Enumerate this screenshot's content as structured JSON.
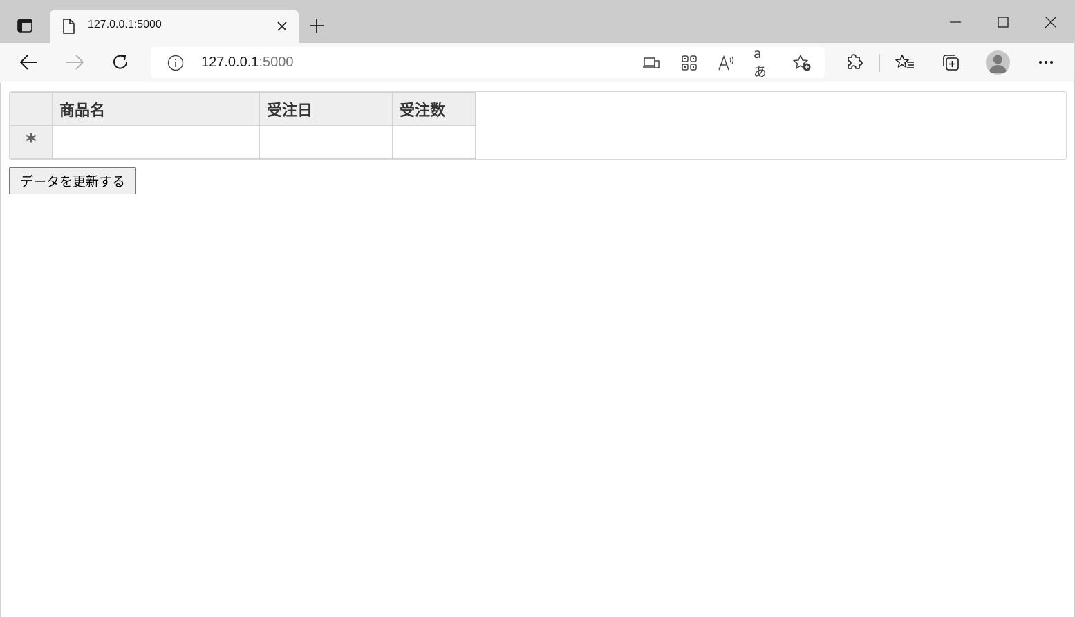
{
  "browser": {
    "tab": {
      "title": "127.0.0.1:5000"
    },
    "address": {
      "host": "127.0.0.1",
      "port": ":5000"
    }
  },
  "icons": {
    "tab_actions": "tab-actions-icon",
    "page": "page-icon",
    "close": "close-icon",
    "new_tab": "plus-icon",
    "back": "back-arrow-icon",
    "forward": "forward-arrow-icon",
    "refresh": "refresh-icon",
    "info": "info-icon",
    "app_available": "app-available-icon",
    "qr": "qr-code-icon",
    "read_aloud": "read-aloud-icon",
    "translate": "translate-icon",
    "add_favorite": "star-plus-icon",
    "extensions": "puzzle-icon",
    "favorites": "favorites-icon",
    "collections": "collections-icon",
    "profile": "profile-avatar",
    "more": "more-icon"
  },
  "grid": {
    "columns": [
      "商品名",
      "受注日",
      "受注数"
    ],
    "new_row_marker": "*"
  },
  "actions": {
    "update_label": "データを更新する"
  },
  "colors": {
    "titlebar": "#cccccc",
    "toolbar": "#f7f7f7",
    "header_bg": "#eeeeee",
    "grid_border": "#d3d3d3"
  }
}
